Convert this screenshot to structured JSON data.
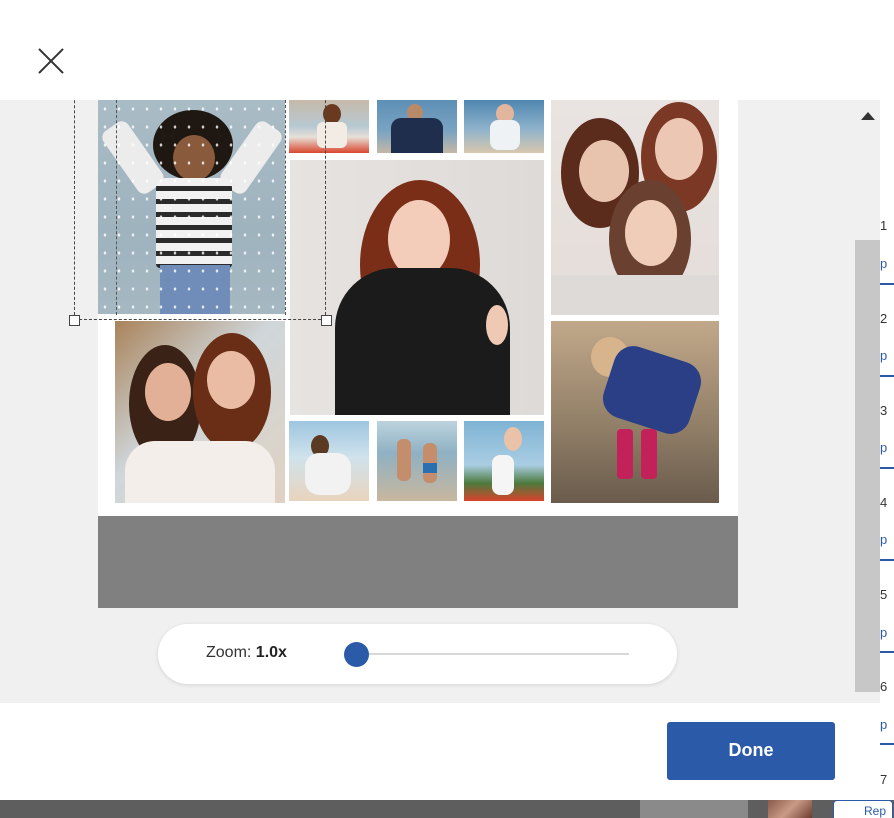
{
  "modal": {
    "close_label": "×",
    "done_label": "Done"
  },
  "zoom": {
    "label": "Zoom: ",
    "value": "1.0x",
    "level": 0.0
  },
  "background": {
    "row_numbers": [
      "1",
      "2",
      "3",
      "4",
      "5",
      "6",
      "7"
    ],
    "link_fragment": "p",
    "bottom_button_fragment": "Rep"
  },
  "colors": {
    "accent": "#2a5aa8",
    "workspace_bg": "#f0f0f0",
    "canvas_gray": "#808080"
  },
  "icons": {
    "close": "close-icon",
    "scroll_up": "caret-up-icon",
    "scroll_down": "caret-down-icon"
  }
}
